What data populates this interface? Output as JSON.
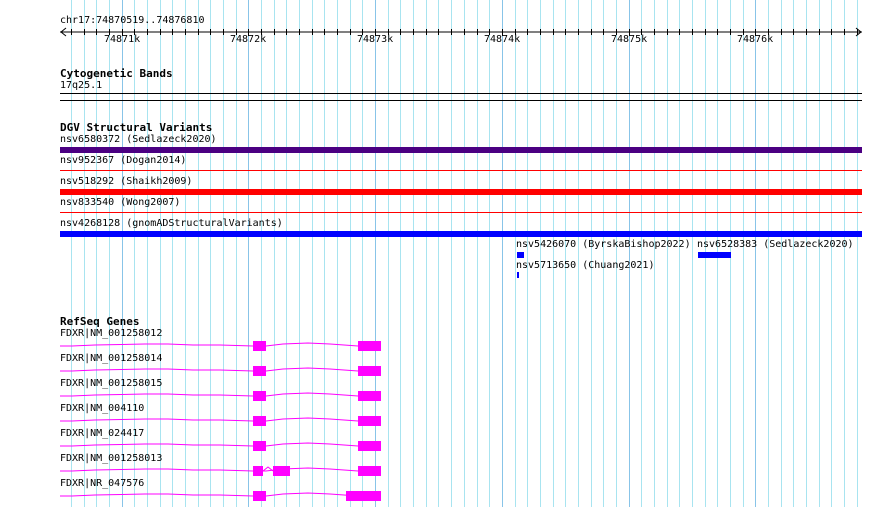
{
  "ruler": {
    "location": "chr17:74870519..74876810",
    "ticks": [
      "74871k",
      "74872k",
      "74873k",
      "74874k",
      "74875k",
      "74876k"
    ]
  },
  "cyto": {
    "title": "Cytogenetic Bands",
    "band": "17q25.1"
  },
  "dgv": {
    "title": "DGV Structural Variants",
    "items": [
      {
        "label": "nsv6580372 (Sedlazeck2020)",
        "color": "#4b0082"
      },
      {
        "label": "nsv952367 (Dogan2014)",
        "color": "#ff0000"
      },
      {
        "label": "nsv518292 (Shaikh2009)",
        "color": "#ff0000"
      },
      {
        "label": "nsv833540 (Wong2007)",
        "color": "#ff0000"
      },
      {
        "label": "nsv4268128 (gnomADStructuralVariants)",
        "color": "#0000ff"
      },
      {
        "label": "nsv5426070 (ByrskaBishop2022)",
        "color": "#0000ff"
      },
      {
        "label": "nsv6528383 (Sedlazeck2020)",
        "color": "#0000ff"
      },
      {
        "label": "nsv5713650 (Chuang2021)",
        "color": "#0000ff"
      }
    ]
  },
  "genes": {
    "title": "RefSeq Genes",
    "color": "#ff00ff",
    "items": [
      "FDXR|NM_001258012",
      "FDXR|NM_001258014",
      "FDXR|NM_001258015",
      "FDXR|NM_004110",
      "FDXR|NM_024417",
      "FDXR|NM_001258013",
      "FDXR|NR_047576"
    ]
  }
}
